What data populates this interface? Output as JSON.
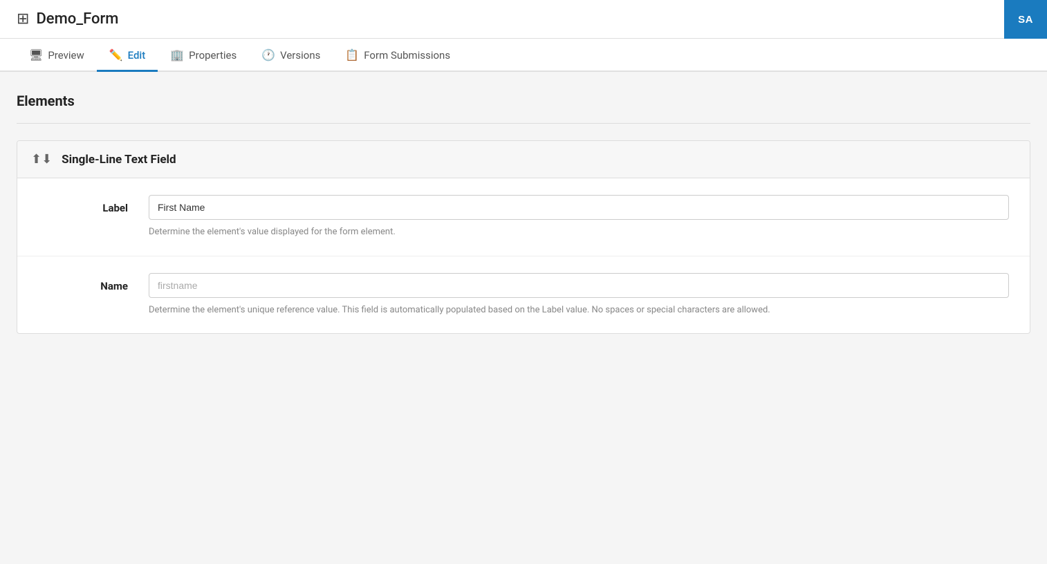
{
  "header": {
    "title": "Demo_Form",
    "grid_icon": "⊞"
  },
  "tabs": [
    {
      "id": "preview",
      "label": "Preview",
      "icon": "🖥",
      "active": false
    },
    {
      "id": "edit",
      "label": "Edit",
      "icon": "✏️",
      "active": true
    },
    {
      "id": "properties",
      "label": "Properties",
      "icon": "🏢",
      "active": false
    },
    {
      "id": "versions",
      "label": "Versions",
      "icon": "🕐",
      "active": false
    },
    {
      "id": "form-submissions",
      "label": "Form Submissions",
      "icon": "📋",
      "active": false
    }
  ],
  "save_button_label": "SA",
  "section": {
    "title": "Elements"
  },
  "element": {
    "type": "Single-Line Text Field",
    "sort_icon": "⬆⬇",
    "fields": [
      {
        "id": "label",
        "label": "Label",
        "input_type": "text",
        "value": "First Name",
        "placeholder": "",
        "hint": "Determine the element's value displayed for the form element."
      },
      {
        "id": "name",
        "label": "Name",
        "input_type": "text",
        "value": "",
        "placeholder": "firstname",
        "hint": "Determine the element's unique reference value. This field is automatically populated based on the Label value. No spaces or special characters are allowed."
      }
    ]
  }
}
